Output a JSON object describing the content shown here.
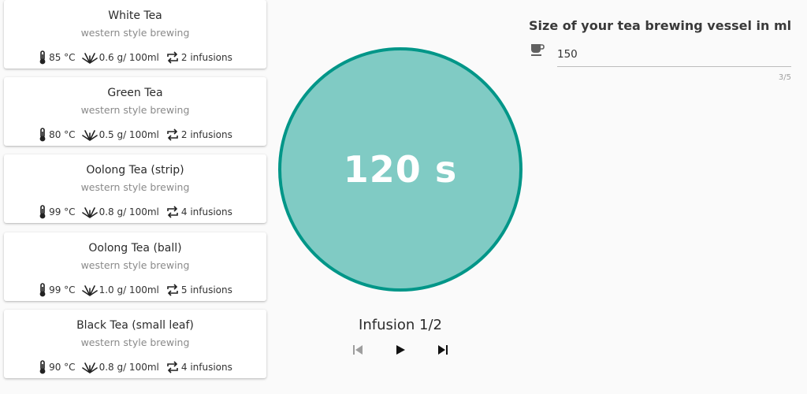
{
  "teas": [
    {
      "name": "White Tea",
      "style": "western style brewing",
      "temp": "85 °C",
      "amount": "0.6 g/ 100ml",
      "infusions": "2 infusions"
    },
    {
      "name": "Green Tea",
      "style": "western style brewing",
      "temp": "80 °C",
      "amount": "0.5 g/ 100ml",
      "infusions": "2 infusions"
    },
    {
      "name": "Oolong Tea (strip)",
      "style": "western style brewing",
      "temp": "99 °C",
      "amount": "0.8 g/ 100ml",
      "infusions": "4 infusions"
    },
    {
      "name": "Oolong Tea (ball)",
      "style": "western style brewing",
      "temp": "99 °C",
      "amount": "1.0 g/ 100ml",
      "infusions": "5 infusions"
    },
    {
      "name": "Black Tea (small leaf)",
      "style": "western style brewing",
      "temp": "90 °C",
      "amount": "0.8 g/ 100ml",
      "infusions": "4 infusions"
    }
  ],
  "timer": {
    "display": "120 s",
    "infusion_label": "Infusion 1/2"
  },
  "vessel": {
    "title": "Size of your tea brewing vessel in ml",
    "value": "150",
    "counter": "3/5"
  },
  "colors": {
    "circle_fill": "#80cbc4",
    "circle_border": "#009688"
  },
  "icons": {
    "thermometer": "thermometer-icon",
    "leaf": "tea-leaf-icon",
    "repeat": "repeat-icon",
    "cup": "coffee-cup-icon",
    "previous": "skip-previous-icon",
    "play": "play-icon",
    "next": "skip-next-icon"
  }
}
